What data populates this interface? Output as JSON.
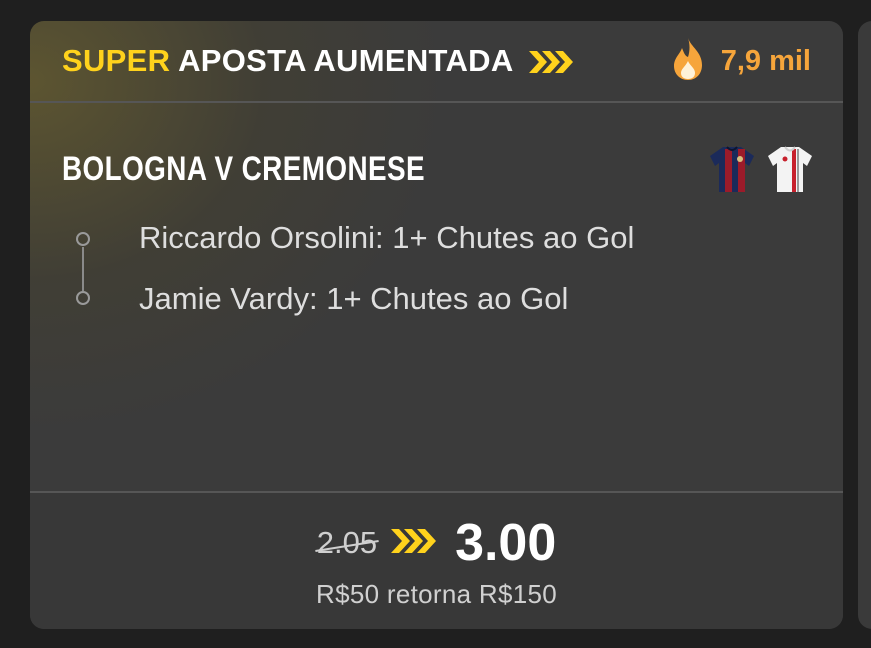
{
  "header": {
    "promo_highlight": "SUPER",
    "promo_rest": "APOSTA AUMENTADA",
    "popularity": "7,9 mil"
  },
  "match": {
    "title": "BOLOGNA V CREMONESE",
    "home_kit": "bologna-shirt-icon",
    "away_kit": "cremonese-shirt-icon"
  },
  "legs": [
    {
      "label": "Riccardo Orsolini: 1+ Chutes ao Gol"
    },
    {
      "label": "Jamie Vardy: 1+ Chutes ao Gol"
    }
  ],
  "odds": {
    "old": "2.05",
    "new": "3.00",
    "returns": "R$50 retorna R$150"
  },
  "colors": {
    "accent_yellow": "#ffd21c",
    "flame_orange": "#f6a53b",
    "card_bg": "#3b3b3b"
  }
}
